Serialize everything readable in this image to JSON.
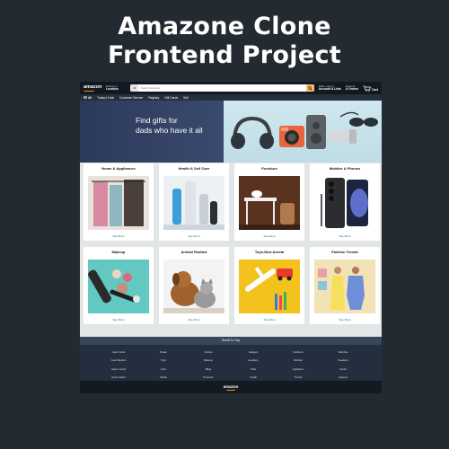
{
  "headline": {
    "line1": "Amazone Clone",
    "line2": "Frontend Project"
  },
  "site": {
    "logo": "amazon",
    "deliver": {
      "small": "Deliver to",
      "big": "Location"
    },
    "search": {
      "category": "All",
      "placeholder": "Search Amazon",
      "icon": "search-icon"
    },
    "account": {
      "small": "Hello, sign in",
      "big": "Account & Lists"
    },
    "returns": {
      "small": "Returns",
      "big": "& Orders"
    },
    "cart": {
      "label": "Cart",
      "icon": "cart-icon"
    },
    "subnav": {
      "menu_label": "All",
      "items": [
        "Today's Deal",
        "Customer Service",
        "Registry",
        "Gift Cards",
        "Sell"
      ]
    },
    "hero": {
      "line1": "Find gifts for",
      "line2": "dads who have it all"
    },
    "cards": [
      {
        "title": "Home & Appliances",
        "link": "See More"
      },
      {
        "title": "Health & Self Care",
        "link": "See More"
      },
      {
        "title": "Furniture",
        "link": "See More"
      },
      {
        "title": "Mobiles & Phones",
        "link": "See More"
      },
      {
        "title": "Makeup",
        "link": "See More"
      },
      {
        "title": "Animal Realted",
        "link": "See More"
      },
      {
        "title": "Toys-New Arrival",
        "link": "See More"
      },
      {
        "title": "Fashion Trends",
        "link": "See More"
      }
    ],
    "back_to_top": "Scroll To Top",
    "footer_links": [
      "Gear Cards",
      "Drawn",
      "Clothes",
      "Gadgets",
      "Fashions",
      "Watches",
      "Gear Repairs",
      "Toys",
      "Makeup",
      "Jewellery",
      "Mobiles",
      "Sneakers",
      "Super Cards",
      "Lists",
      "Bags",
      "Polls",
      "Appliance",
      "Socks",
      "Gear Collect",
      "Media",
      "Presents",
      "Jungle",
      "Trends",
      "Laptops"
    ],
    "footer_logo": "amazon"
  },
  "colors": {
    "page_bg": "#232a31",
    "nav_dark": "#131921",
    "nav_sub": "#232f3e",
    "accent": "#febd69",
    "link": "#007185"
  }
}
